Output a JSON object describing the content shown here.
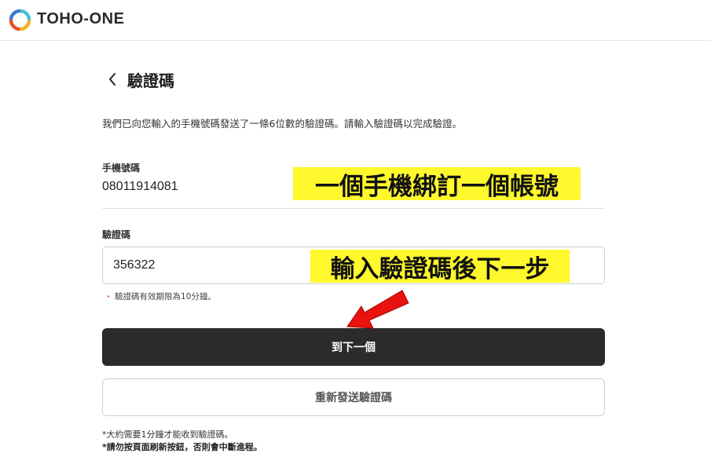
{
  "header": {
    "brand": "TOHO-ONE",
    "logo_colors": [
      "#f5b21c",
      "#e94b2b",
      "#3a7bd5",
      "#45c0d8"
    ]
  },
  "page": {
    "back_icon": "chevron-left-icon",
    "title": "驗證碼",
    "description": "我們已向您輸入的手機號碼發送了一條6位數的驗證碼。請輸入驗證碼以完成驗證。"
  },
  "phone": {
    "label": "手機號碼",
    "value": "08011914081"
  },
  "code": {
    "label": "驗證碼",
    "value": "356322",
    "hint": "驗證碼有效期限為10分鐘。"
  },
  "buttons": {
    "next": "到下一個",
    "resend": "重新發送驗證碼"
  },
  "notes": {
    "line1": "*大約需要1分鐘才能收到驗證碼。",
    "line2": "*請勿按頁面刷新按鈕，否則會中斷進程。"
  },
  "annotations": {
    "one_phone_one_account": "一個手機綁訂一個帳號",
    "enter_code_next": "輸入驗證碼後下一步",
    "highlight_color": "#fff82c",
    "arrow_color": "#e8120f"
  }
}
